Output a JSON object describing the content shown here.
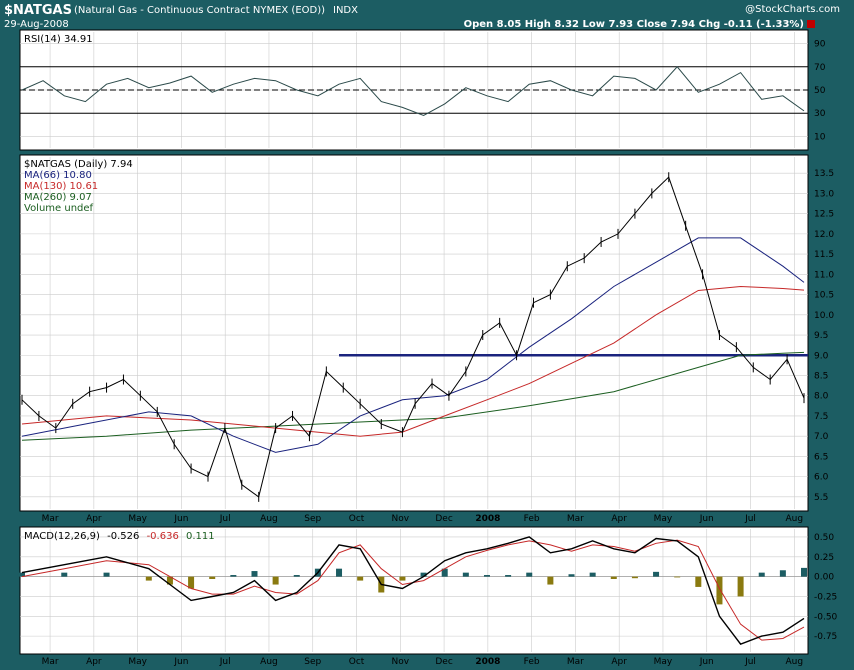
{
  "header": {
    "symbol": "$NATGAS",
    "description": "(Natural Gas - Continuous Contract NYMEX (EOD))",
    "exchange": "INDX",
    "date": "29-Aug-2008",
    "copyright": "@StockCharts.com",
    "quote": "Open 8.05  High 8.32  Low 7.93  Close 7.94  Chg -0.11 (-1.33%)"
  },
  "chart_data": {
    "type": "line",
    "months": [
      "Mar",
      "Apr",
      "May",
      "Jun",
      "Jul",
      "Aug",
      "Sep",
      "Oct",
      "Nov",
      "Dec",
      "2008",
      "Feb",
      "Mar",
      "Apr",
      "May",
      "Jun",
      "Jul",
      "Aug"
    ],
    "rsi_panel": {
      "legend": "RSI(14) 34.91",
      "y_ticks": [
        10,
        30,
        50,
        70,
        90
      ],
      "ylim": [
        0,
        100
      ],
      "overbought": 70,
      "center": 50,
      "oversold": 30,
      "x": [
        0,
        10,
        20,
        30,
        40,
        50,
        60,
        70,
        80,
        90,
        100,
        110,
        120,
        130,
        140,
        150,
        160,
        170,
        180,
        190,
        200,
        210,
        220,
        230,
        240,
        250,
        260,
        270,
        280,
        290,
        300,
        310,
        320,
        330,
        340,
        350,
        360,
        370
      ],
      "values": [
        50,
        58,
        45,
        40,
        55,
        60,
        52,
        56,
        62,
        48,
        55,
        60,
        58,
        50,
        45,
        55,
        60,
        40,
        35,
        28,
        38,
        52,
        45,
        40,
        55,
        58,
        50,
        45,
        62,
        60,
        50,
        70,
        48,
        55,
        65,
        42,
        45,
        32
      ]
    },
    "price_panel": {
      "legend": [
        "$NATGAS (Daily) 7.94",
        "MA(66) 10.80",
        "MA(130) 10.61",
        "MA(260) 9.07",
        "Volume undef"
      ],
      "y_ticks": [
        5.5,
        6.0,
        6.5,
        7.0,
        7.5,
        8.0,
        8.5,
        9.0,
        9.5,
        10.0,
        10.5,
        11.0,
        11.5,
        12.0,
        12.5,
        13.0,
        13.5
      ],
      "ylim": [
        5.2,
        13.9
      ],
      "resistance_level": 9.0,
      "price": {
        "x": [
          0,
          8,
          16,
          24,
          32,
          40,
          48,
          56,
          64,
          72,
          80,
          88,
          96,
          104,
          112,
          120,
          128,
          136,
          144,
          152,
          160,
          170,
          180,
          186,
          194,
          202,
          210,
          218,
          226,
          234,
          242,
          250,
          258,
          266,
          274,
          282,
          290,
          298,
          306,
          314,
          322,
          330,
          338,
          346,
          354,
          362,
          370
        ],
        "values": [
          7.9,
          7.5,
          7.2,
          7.8,
          8.1,
          8.2,
          8.4,
          8.0,
          7.6,
          6.8,
          6.2,
          6.0,
          7.2,
          5.8,
          5.5,
          7.2,
          7.5,
          7.0,
          8.6,
          8.2,
          7.8,
          7.3,
          7.1,
          7.8,
          8.3,
          8.0,
          8.6,
          9.5,
          9.8,
          9.0,
          10.3,
          10.5,
          11.2,
          11.4,
          11.8,
          12.0,
          12.5,
          13.0,
          13.4,
          12.2,
          11.0,
          9.5,
          9.2,
          8.7,
          8.4,
          8.9,
          7.94
        ]
      },
      "ma66": {
        "x": [
          0,
          30,
          60,
          80,
          100,
          120,
          140,
          160,
          180,
          200,
          220,
          240,
          260,
          280,
          300,
          320,
          340,
          360,
          370
        ],
        "values": [
          7.0,
          7.3,
          7.6,
          7.5,
          7.0,
          6.6,
          6.8,
          7.5,
          7.9,
          8.0,
          8.4,
          9.2,
          9.9,
          10.7,
          11.3,
          11.9,
          11.9,
          11.2,
          10.8
        ]
      },
      "ma130": {
        "x": [
          0,
          40,
          80,
          120,
          160,
          180,
          200,
          220,
          240,
          260,
          280,
          300,
          320,
          340,
          360,
          370
        ],
        "values": [
          7.3,
          7.5,
          7.4,
          7.2,
          7.0,
          7.1,
          7.5,
          7.9,
          8.3,
          8.8,
          9.3,
          10.0,
          10.6,
          10.7,
          10.65,
          10.61
        ]
      },
      "ma260": {
        "x": [
          0,
          40,
          80,
          120,
          160,
          200,
          240,
          280,
          320,
          340,
          360,
          370
        ],
        "values": [
          6.9,
          7.0,
          7.15,
          7.25,
          7.35,
          7.45,
          7.75,
          8.1,
          8.7,
          9.0,
          9.05,
          9.07
        ]
      }
    },
    "macd_panel": {
      "legend_prefix": "MACD(12,26,9)",
      "macd_value": "-0.526",
      "signal_value": "-0.636",
      "hist_value": "0.111",
      "y_ticks": [
        0.5,
        0.25,
        0.0,
        -0.25,
        -0.5,
        -0.75
      ],
      "ylim": [
        -0.95,
        0.6
      ],
      "macd": {
        "x": [
          0,
          20,
          40,
          60,
          70,
          80,
          90,
          100,
          110,
          120,
          130,
          140,
          150,
          160,
          170,
          180,
          190,
          200,
          210,
          220,
          230,
          240,
          250,
          260,
          270,
          280,
          290,
          300,
          310,
          320,
          330,
          340,
          350,
          360,
          370
        ],
        "values": [
          0.05,
          0.15,
          0.25,
          0.1,
          -0.1,
          -0.3,
          -0.25,
          -0.2,
          -0.05,
          -0.3,
          -0.2,
          0.05,
          0.4,
          0.35,
          -0.1,
          -0.15,
          0.0,
          0.2,
          0.3,
          0.35,
          0.42,
          0.5,
          0.3,
          0.35,
          0.45,
          0.35,
          0.3,
          0.48,
          0.45,
          0.25,
          -0.5,
          -0.85,
          -0.75,
          -0.7,
          -0.526
        ]
      },
      "signal": {
        "x": [
          0,
          20,
          40,
          60,
          70,
          80,
          90,
          100,
          110,
          120,
          130,
          140,
          150,
          160,
          170,
          180,
          190,
          200,
          210,
          220,
          230,
          240,
          250,
          260,
          270,
          280,
          290,
          300,
          310,
          320,
          330,
          340,
          350,
          360,
          370
        ],
        "values": [
          0.0,
          0.1,
          0.2,
          0.15,
          0.0,
          -0.15,
          -0.22,
          -0.22,
          -0.12,
          -0.2,
          -0.22,
          -0.05,
          0.3,
          0.4,
          0.1,
          -0.1,
          -0.05,
          0.1,
          0.25,
          0.33,
          0.4,
          0.45,
          0.4,
          0.32,
          0.4,
          0.38,
          0.32,
          0.42,
          0.46,
          0.38,
          -0.15,
          -0.6,
          -0.8,
          -0.78,
          -0.636
        ]
      }
    }
  }
}
